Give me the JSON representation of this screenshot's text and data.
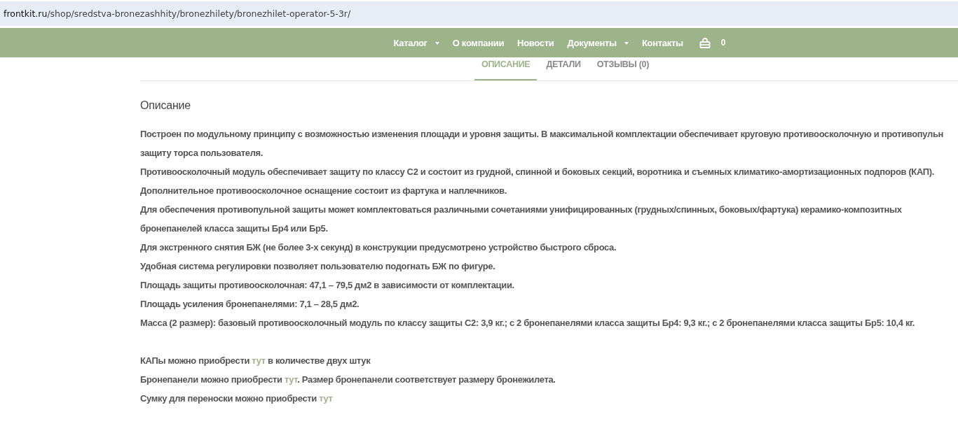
{
  "address_bar": {
    "domain": "frontkit.ru",
    "path": "/shop/sredstva-bronezashhity/bronezhilety/bronezhilet-operator-5-3r/"
  },
  "nav": {
    "items": [
      {
        "label": "Каталог",
        "dropdown": true
      },
      {
        "label": "О компании",
        "dropdown": false
      },
      {
        "label": "Новости",
        "dropdown": false
      },
      {
        "label": "Документы",
        "dropdown": true
      },
      {
        "label": "Контакты",
        "dropdown": false
      }
    ],
    "cart_count": "0"
  },
  "tabs": [
    {
      "label": "ОПИСАНИЕ",
      "selected": true
    },
    {
      "label": "ДЕТАЛИ",
      "selected": false
    },
    {
      "label": "ОТЗЫВЫ (0)",
      "selected": false
    }
  ],
  "heading": "Описание",
  "paragraphs": [
    {
      "lines": [
        "Построен по модульному принципу с возможностью изменения площади и уровня защиты. В максимальной комплектации обеспечивает круговую противоосколочную и противопульн",
        "защиту торса пользователя."
      ]
    },
    {
      "lines": [
        "Противоосколочный модуль обеспечивает защиту по классу С2 и состоит из грудной, спинной и боковых секций, воротника и съемных климатико-амортизационных подпоров (КАП)."
      ]
    },
    {
      "lines": [
        "Дополнительное противоосколочное оснащение состоит из фартука и наплечников."
      ]
    },
    {
      "lines": [
        "Для обеспечения противопульной защиты может комплектоваться различными сочетаниями унифицированных (грудных/спинных, боковых/фартука) керамико-композитных",
        "бронепанелей класса защиты Бр4 или Бр5."
      ]
    },
    {
      "lines": [
        "Для экстренного снятия БЖ (не более 3-х секунд) в конструкции предусмотрено устройство быстрого сброса."
      ]
    },
    {
      "lines": [
        "Удобная система регулировки позволяет пользователю подогнать БЖ по фигуре."
      ]
    },
    {
      "lines": [
        "Площадь защиты противоосколочная: 47,1 – 79,5 дм2 в зависимости от комплектации."
      ]
    },
    {
      "lines": [
        "Площадь усиления бронепанелями: 7,1 – 28,5 дм2."
      ]
    },
    {
      "lines": [
        "Масса (2 размер): базовый противоосколочный модуль по классу защиты С2: 3,9 кг.; с 2 бронепанелями класса защиты Бр4: 9,3 кг.; с 2 бронепанелями класса защиты Бр5: 10,4 кг."
      ]
    }
  ],
  "purchase_notes": [
    {
      "parts": [
        {
          "kind": "text",
          "text": "КАПы можно приобрести "
        },
        {
          "kind": "link",
          "text": "тут"
        },
        {
          "kind": "text",
          "text": " в количестве двух штук"
        }
      ]
    },
    {
      "parts": [
        {
          "kind": "text",
          "text": "Бронепанели можно приобрести "
        },
        {
          "kind": "link",
          "text": "тут"
        },
        {
          "kind": "text",
          "text": ". Размер бронепанели соответствует размеру бронежилета."
        }
      ]
    },
    {
      "parts": [
        {
          "kind": "text",
          "text": "Сумку для переноски можно приобрести "
        },
        {
          "kind": "link",
          "text": "тут"
        }
      ]
    }
  ]
}
